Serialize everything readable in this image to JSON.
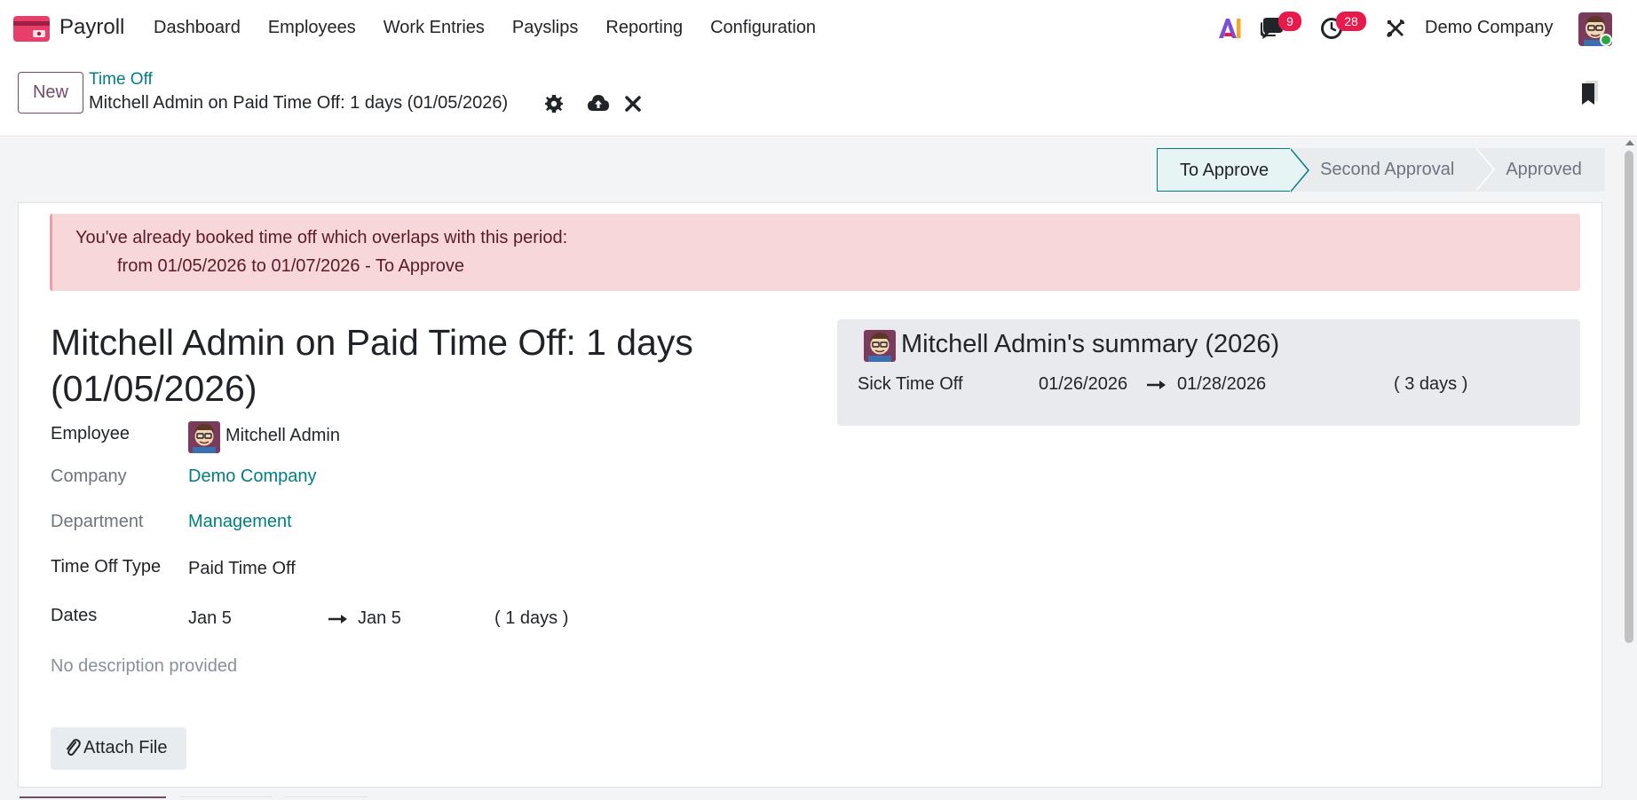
{
  "app": {
    "name": "Payroll",
    "logo_icon": "payroll-card-icon"
  },
  "menu": [
    "Dashboard",
    "Employees",
    "Work Entries",
    "Payslips",
    "Reporting",
    "Configuration"
  ],
  "systray": {
    "ai_icon": "ai-icon",
    "messages_count": "9",
    "activities_count": "28",
    "company": "Demo Company"
  },
  "control_panel": {
    "new_label": "New",
    "breadcrumb": "Time Off",
    "title": "Mitchell Admin on Paid Time Off: 1 days (01/05/2026)"
  },
  "statusbar": {
    "stages": [
      "To Approve",
      "Second Approval",
      "Approved"
    ],
    "current": "To Approve"
  },
  "alert": {
    "line1": "You've already booked time off which overlaps with this period:",
    "line2": "from 01/05/2026 to 01/07/2026 - To Approve"
  },
  "form": {
    "title": "Mitchell Admin on Paid Time Off: 1 days (01/05/2026)",
    "fields": {
      "employee_label": "Employee",
      "employee_value": "Mitchell Admin",
      "company_label": "Company",
      "company_value": "Demo Company",
      "department_label": "Department",
      "department_value": "Management",
      "type_label": "Time Off Type",
      "type_value": "Paid Time Off",
      "dates_label": "Dates",
      "date_from": "Jan 5",
      "date_to": "Jan 5",
      "duration": "( 1 days )"
    },
    "description_placeholder": "No description provided",
    "attach_label": "Attach File"
  },
  "summary": {
    "title": "Mitchell Admin's summary (2026)",
    "rows": [
      {
        "type": "Sick Time Off",
        "from": "01/26/2026",
        "to": "01/28/2026",
        "days": "( 3 days )"
      }
    ]
  },
  "colors": {
    "brand": "#714b67",
    "link": "#017e84",
    "alert_bg": "#f8d7da",
    "badge": "#e8194b"
  }
}
